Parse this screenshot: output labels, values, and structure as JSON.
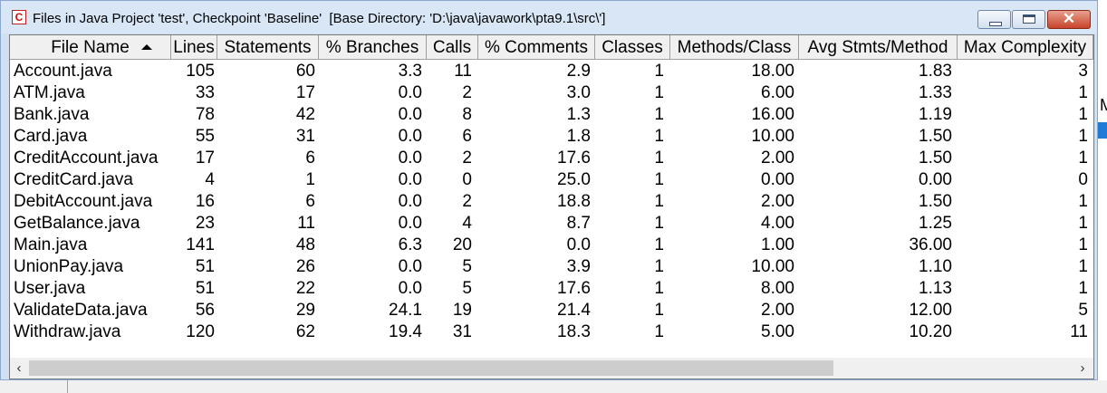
{
  "window": {
    "title": "Files in Java Project 'test', Checkpoint 'Baseline'  [Base Directory: 'D:\\java\\javawork\\pta9.1\\src\\']",
    "icon": "app-icon",
    "icon_letter": "C"
  },
  "table": {
    "columns": [
      "File Name",
      "Lines",
      "Statements",
      "% Branches",
      "Calls",
      "% Comments",
      "Classes",
      "Methods/Class",
      "Avg Stmts/Method",
      "Max Complexity"
    ],
    "sort_column": "File Name",
    "sort_direction": "ascending",
    "rows": [
      [
        "Account.java",
        "105",
        "60",
        "3.3",
        "11",
        "2.9",
        "1",
        "18.00",
        "1.83",
        "3"
      ],
      [
        "ATM.java",
        "33",
        "17",
        "0.0",
        "2",
        "3.0",
        "1",
        "6.00",
        "1.33",
        "1"
      ],
      [
        "Bank.java",
        "78",
        "42",
        "0.0",
        "8",
        "1.3",
        "1",
        "16.00",
        "1.19",
        "1"
      ],
      [
        "Card.java",
        "55",
        "31",
        "0.0",
        "6",
        "1.8",
        "1",
        "10.00",
        "1.50",
        "1"
      ],
      [
        "CreditAccount.java",
        "17",
        "6",
        "0.0",
        "2",
        "17.6",
        "1",
        "2.00",
        "1.50",
        "1"
      ],
      [
        "CreditCard.java",
        "4",
        "1",
        "0.0",
        "0",
        "25.0",
        "1",
        "0.00",
        "0.00",
        "0"
      ],
      [
        "DebitAccount.java",
        "16",
        "6",
        "0.0",
        "2",
        "18.8",
        "1",
        "2.00",
        "1.50",
        "1"
      ],
      [
        "GetBalance.java",
        "23",
        "11",
        "0.0",
        "4",
        "8.7",
        "1",
        "4.00",
        "1.25",
        "1"
      ],
      [
        "Main.java",
        "141",
        "48",
        "6.3",
        "20",
        "0.0",
        "1",
        "1.00",
        "36.00",
        "1"
      ],
      [
        "UnionPay.java",
        "51",
        "26",
        "0.0",
        "5",
        "3.9",
        "1",
        "10.00",
        "1.10",
        "1"
      ],
      [
        "User.java",
        "51",
        "22",
        "0.0",
        "5",
        "17.6",
        "1",
        "8.00",
        "1.13",
        "1"
      ],
      [
        "ValidateData.java",
        "56",
        "29",
        "24.1",
        "19",
        "21.4",
        "1",
        "2.00",
        "12.00",
        "5"
      ],
      [
        "Withdraw.java",
        "120",
        "62",
        "19.4",
        "31",
        "18.3",
        "1",
        "5.00",
        "10.20",
        "11"
      ]
    ]
  },
  "scrollbar": {
    "left_arrow": "‹",
    "right_arrow": "›"
  },
  "background": {
    "fragment_text": "M"
  }
}
